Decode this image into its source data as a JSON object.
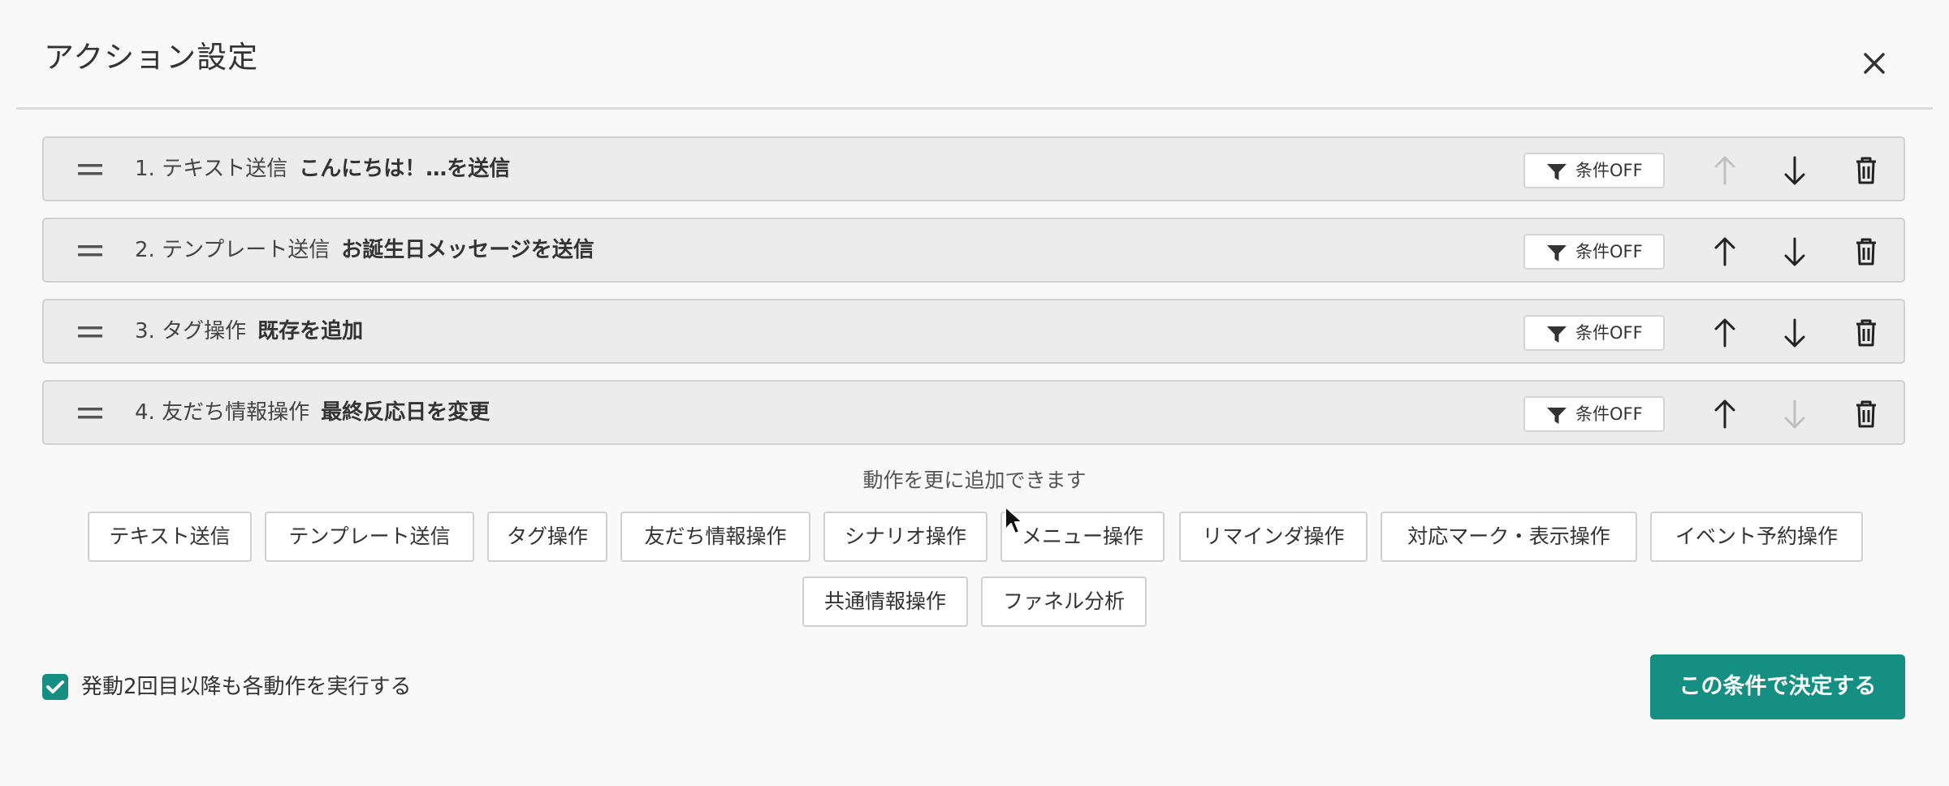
{
  "dialog": {
    "title": "アクション設定",
    "close_icon": "close-icon"
  },
  "actions": [
    {
      "label": "1. テキスト送信",
      "summary": "こんにちは！…を送信",
      "condition": "条件OFF",
      "up_enabled": false,
      "down_enabled": true
    },
    {
      "label": "2. テンプレート送信",
      "summary": "お誕生日メッセージを送信",
      "condition": "条件OFF",
      "up_enabled": true,
      "down_enabled": true
    },
    {
      "label": "3. タグ操作",
      "summary": "既存を追加",
      "condition": "条件OFF",
      "up_enabled": true,
      "down_enabled": true
    },
    {
      "label": "4. 友だち情報操作",
      "summary": "最終反応日を変更",
      "condition": "条件OFF",
      "up_enabled": true,
      "down_enabled": false
    }
  ],
  "add_hint": "動作を更に追加できます",
  "add_buttons": [
    "テキスト送信",
    "テンプレート送信",
    "タグ操作",
    "友だち情報操作",
    "シナリオ操作",
    "メニュー操作",
    "リマインダ操作",
    "対応マーク・表示操作",
    "イベント予約操作",
    "共通情報操作",
    "ファネル分析"
  ],
  "footer": {
    "checkbox_label": "発動2回目以降も各動作を実行する",
    "checkbox_checked": true,
    "submit_label": "この条件で決定する"
  },
  "colors": {
    "accent": "#168f83",
    "row_bg": "#ececec",
    "page_bg": "#f9f9f9"
  }
}
